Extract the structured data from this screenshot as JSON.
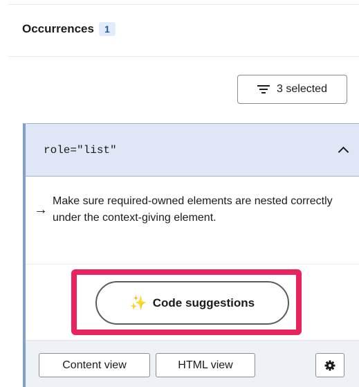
{
  "occurrences": {
    "title": "Occurrences",
    "count": "1"
  },
  "filter": {
    "label": "3 selected",
    "icon": "filter-icon"
  },
  "card": {
    "title": "role=\"list\"",
    "description": "Make sure required-owned elements are nested correctly under the context-giving element.",
    "code_suggestions_label": "Code suggestions",
    "buttons": {
      "content_view": "Content view",
      "html_view": "HTML view"
    }
  },
  "colors": {
    "highlight": "#e8245e",
    "card_header_bg": "#dfe7f6",
    "badge_bg": "#e0ecfa"
  }
}
